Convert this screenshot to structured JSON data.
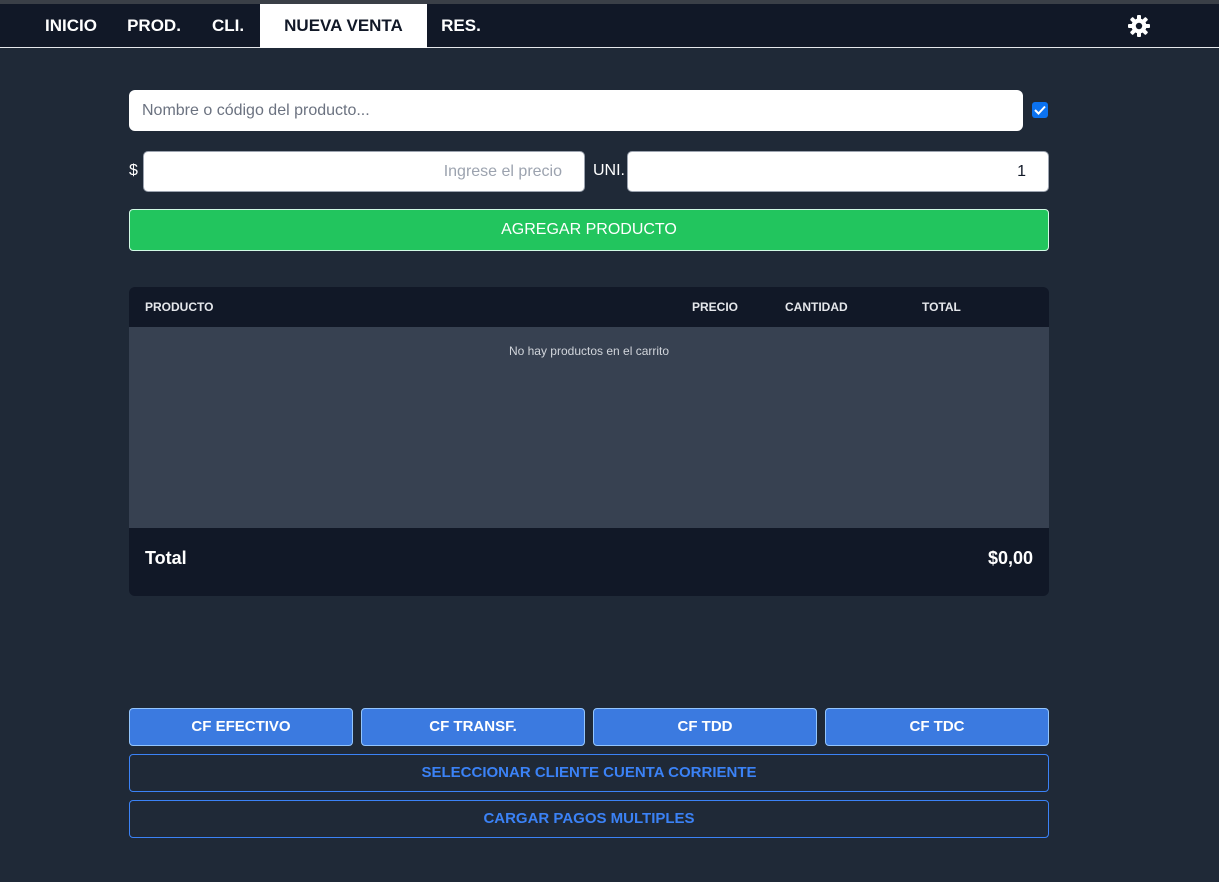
{
  "nav": {
    "tabs": [
      {
        "label": "INICIO"
      },
      {
        "label": "PROD."
      },
      {
        "label": "CLI."
      },
      {
        "label": "NUEVA VENTA"
      },
      {
        "label": "RES."
      }
    ],
    "active_tab": "NUEVA VENTA",
    "settings_icon": "gear-icon"
  },
  "search": {
    "placeholder": "Nombre o código del producto...",
    "value": "",
    "checkbox_checked": true
  },
  "price": {
    "currency_label": "$",
    "placeholder": "Ingrese el precio",
    "value": ""
  },
  "quantity": {
    "label": "UNI.",
    "value": "1"
  },
  "add_button": {
    "label": "AGREGAR PRODUCTO"
  },
  "cart": {
    "columns": [
      "PRODUCTO",
      "PRECIO",
      "CANTIDAD",
      "TOTAL"
    ],
    "rows": [],
    "empty_message": "No hay productos en el carrito",
    "total_label": "Total",
    "total_value": "$0,00"
  },
  "payments": {
    "buttons": [
      {
        "label": "CF EFECTIVO"
      },
      {
        "label": "CF TRANSF."
      },
      {
        "label": "CF TDD"
      },
      {
        "label": "CF TDC"
      }
    ],
    "select_client_label": "SELECCIONAR CLIENTE CUENTA CORRIENTE",
    "multiple_payments_label": "CARGAR PAGOS MULTIPLES"
  },
  "colors": {
    "background": "#1f2937",
    "nav": "#111827",
    "accent_green": "#22c55e",
    "accent_blue": "#3b7ae0",
    "outline_blue": "#3b82f6"
  }
}
